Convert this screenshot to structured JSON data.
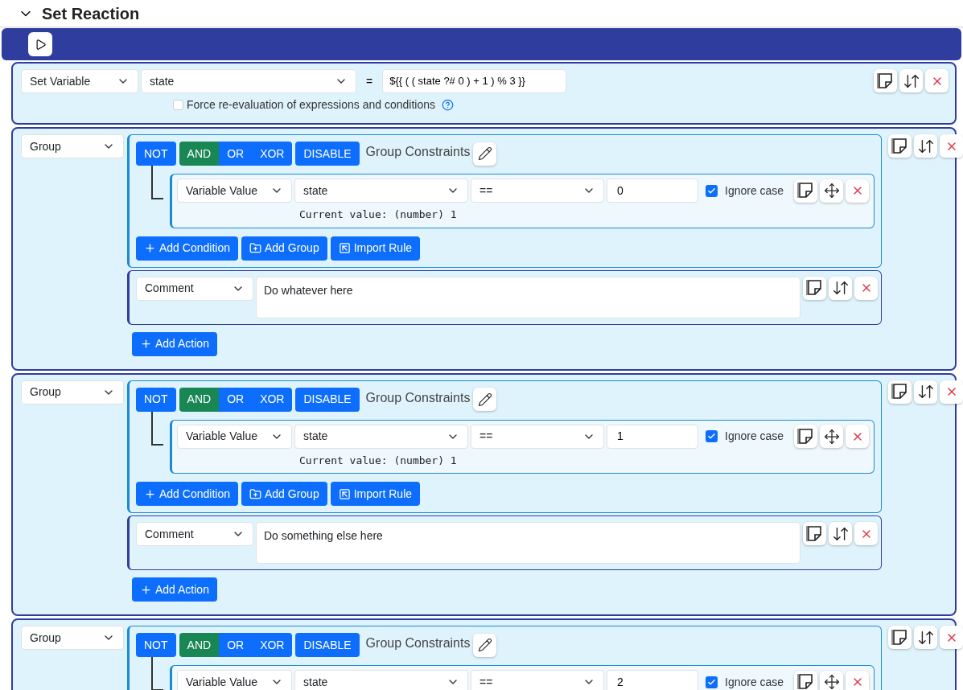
{
  "header": {
    "title": "Set Reaction",
    "expanded": true
  },
  "actions": [
    {
      "kind": "set_variable",
      "type": "Set Variable",
      "variable": "state",
      "operator": "=",
      "value": "${{ ( ( state ?# 0 ) + 1 ) % 3 }}",
      "force": {
        "label": "Force re-evaluation of expressions and conditions",
        "checked": false
      }
    },
    {
      "kind": "group",
      "type": "Group",
      "not": "NOT",
      "logic": [
        {
          "label": "AND",
          "selected": true
        },
        {
          "label": "OR",
          "selected": false
        },
        {
          "label": "XOR",
          "selected": false
        }
      ],
      "disable": "DISABLE",
      "title": "Group Constraints",
      "conditions": [
        {
          "type": "Variable Value",
          "variable": "state",
          "operator": "==",
          "value": "0",
          "ignore_case": {
            "label": "Ignore case",
            "checked": true
          },
          "current_value": "Current value: (number) 1"
        }
      ],
      "buttons": [
        "Add Condition",
        "Add Group",
        "Import Rule"
      ],
      "actions": [
        {
          "kind": "comment",
          "type": "Comment",
          "text": "Do whatever here"
        }
      ],
      "add_action": "Add Action"
    },
    {
      "kind": "group",
      "type": "Group",
      "not": "NOT",
      "logic": [
        {
          "label": "AND",
          "selected": true
        },
        {
          "label": "OR",
          "selected": false
        },
        {
          "label": "XOR",
          "selected": false
        }
      ],
      "disable": "DISABLE",
      "title": "Group Constraints",
      "conditions": [
        {
          "type": "Variable Value",
          "variable": "state",
          "operator": "==",
          "value": "1",
          "ignore_case": {
            "label": "Ignore case",
            "checked": true
          },
          "current_value": "Current value: (number) 1"
        }
      ],
      "buttons": [
        "Add Condition",
        "Add Group",
        "Import Rule"
      ],
      "actions": [
        {
          "kind": "comment",
          "type": "Comment",
          "text": "Do something else here"
        }
      ],
      "add_action": "Add Action"
    },
    {
      "kind": "group",
      "type": "Group",
      "not": "NOT",
      "logic": [
        {
          "label": "AND",
          "selected": true
        },
        {
          "label": "OR",
          "selected": false
        },
        {
          "label": "XOR",
          "selected": false
        }
      ],
      "disable": "DISABLE",
      "title": "Group Constraints",
      "conditions": [
        {
          "type": "Variable Value",
          "variable": "state",
          "operator": "==",
          "value": "2",
          "ignore_case": {
            "label": "Ignore case",
            "checked": true
          }
        }
      ]
    }
  ]
}
